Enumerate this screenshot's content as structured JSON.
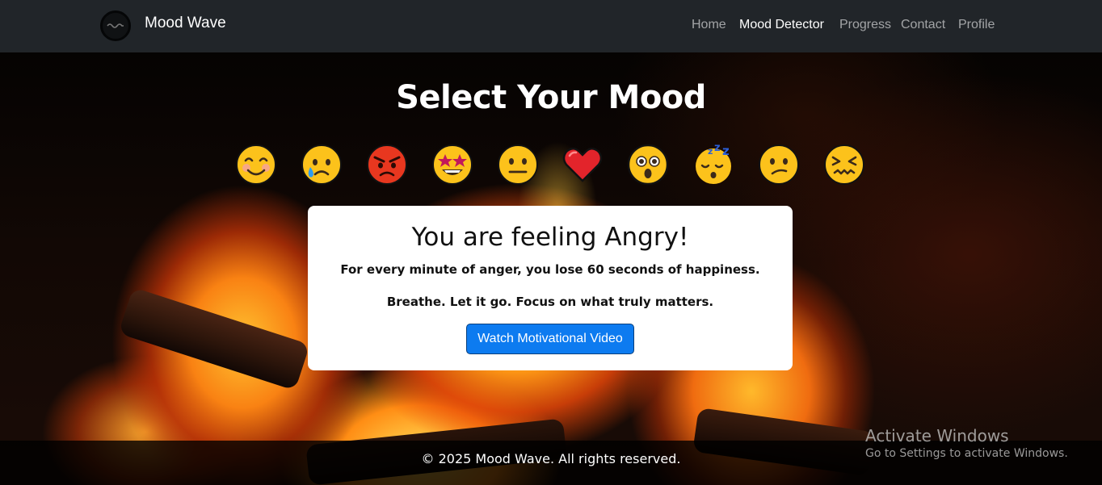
{
  "brand": {
    "name": "Mood Wave",
    "logo_icon": "wave-logo-icon"
  },
  "nav": {
    "items": [
      {
        "label": "Home",
        "active": false
      },
      {
        "label": "Mood Detector",
        "active": true
      },
      {
        "label": "Progress",
        "active": false
      },
      {
        "label": "Contact",
        "active": false
      },
      {
        "label": "Profile",
        "active": false
      }
    ]
  },
  "hero": {
    "title": "Select Your Mood",
    "moods": [
      {
        "icon": "smiling-face-icon"
      },
      {
        "icon": "crying-face-icon"
      },
      {
        "icon": "angry-face-icon"
      },
      {
        "icon": "star-struck-face-icon"
      },
      {
        "icon": "neutral-face-icon"
      },
      {
        "icon": "red-heart-icon"
      },
      {
        "icon": "astonished-face-icon"
      },
      {
        "icon": "sleeping-face-icon"
      },
      {
        "icon": "confused-face-icon"
      },
      {
        "icon": "confounded-face-icon"
      }
    ]
  },
  "result_card": {
    "title": "You are feeling Angry!",
    "line1": "For every minute of anger, you lose 60 seconds of happiness.",
    "line2": "Breathe. Let it go. Focus on what truly matters.",
    "button_label": "Watch Motivational Video"
  },
  "footer": {
    "text": "© 2025 Mood Wave. All rights reserved."
  },
  "watermark": {
    "title": "Activate Windows",
    "subtitle": "Go to Settings to activate Windows."
  },
  "colors": {
    "navbar": "#212529",
    "button": "#0d7bf0",
    "card": "#ffffff"
  }
}
